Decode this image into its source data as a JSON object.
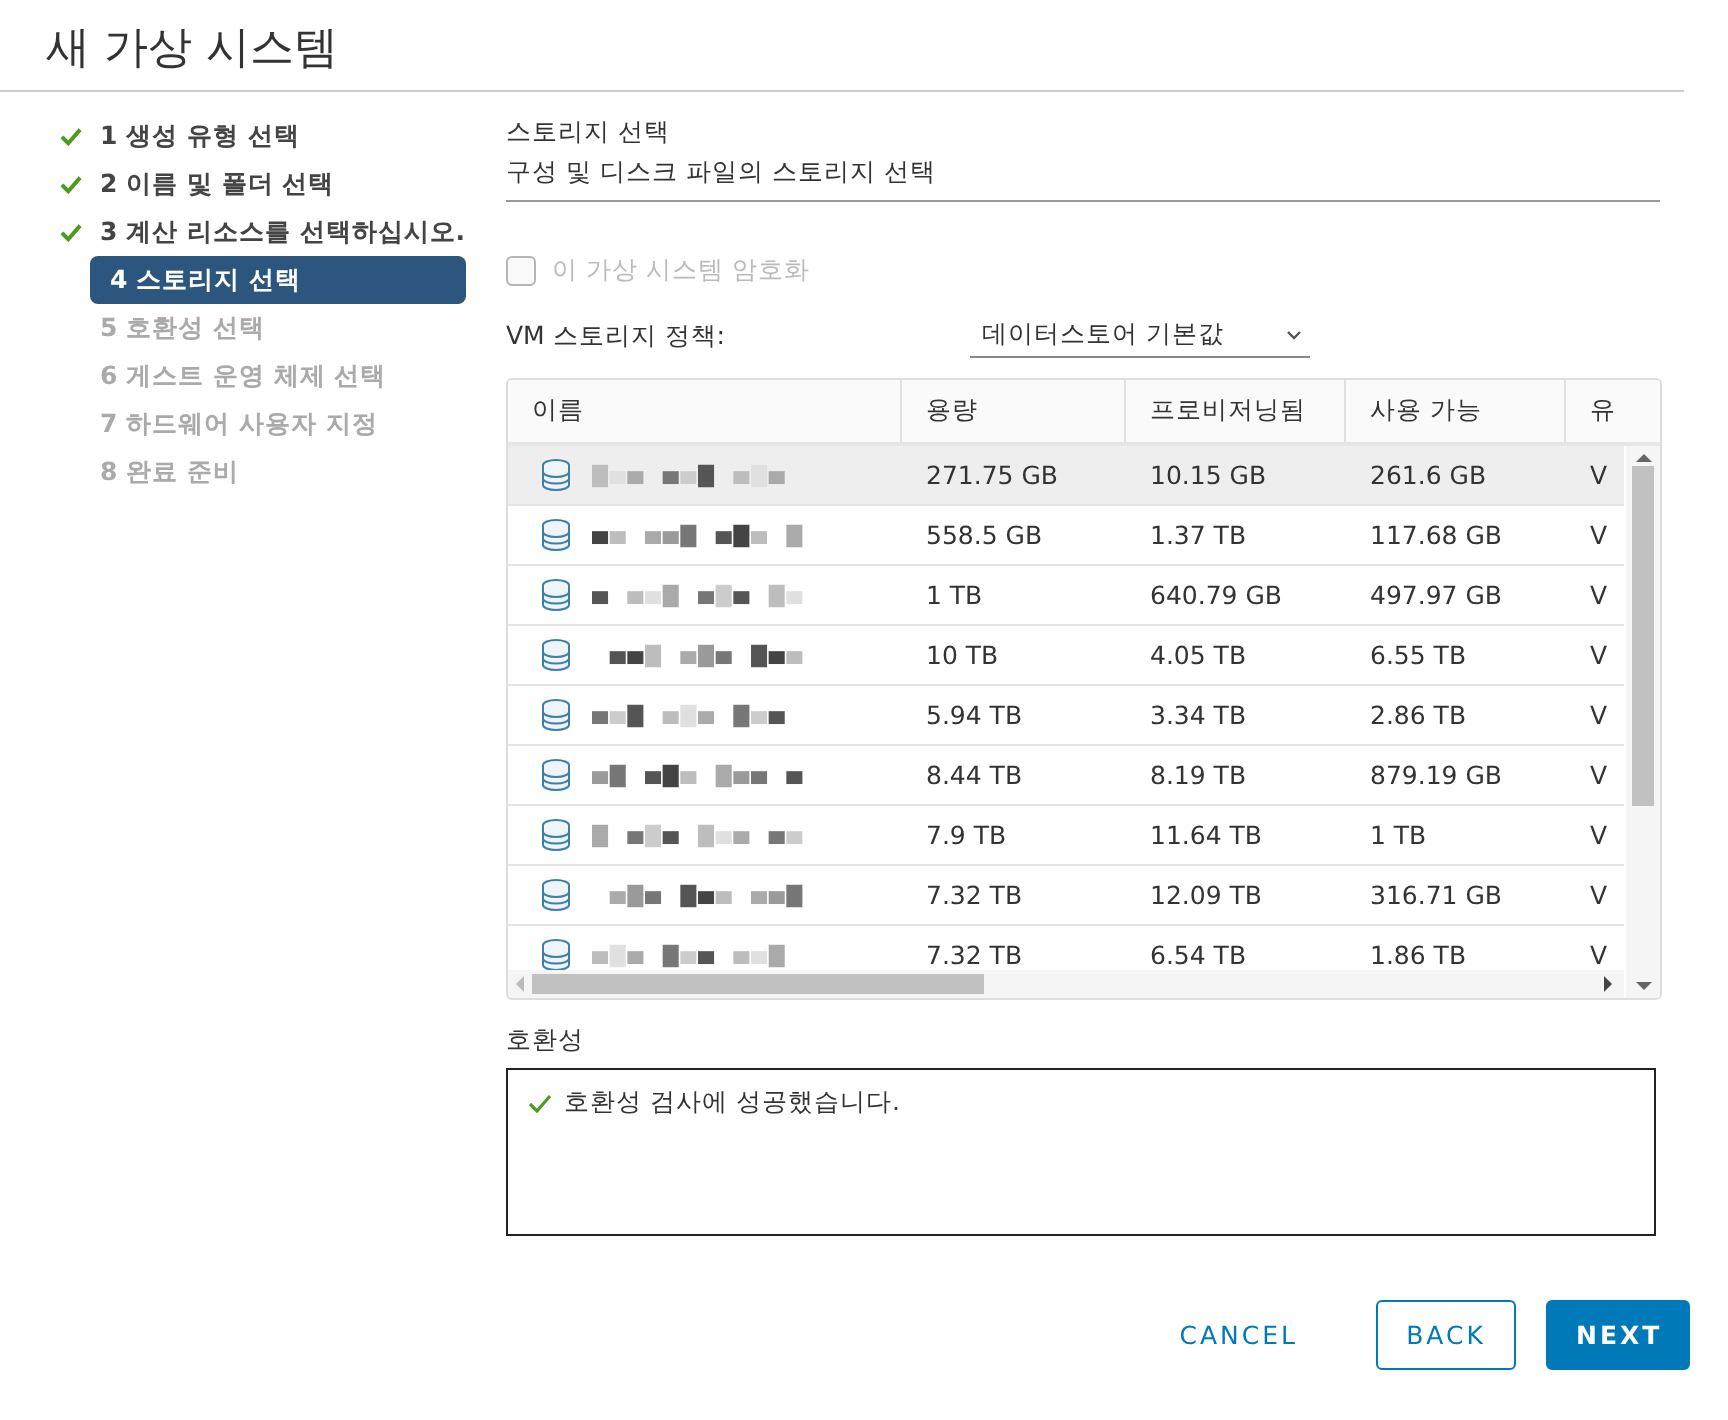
{
  "window": {
    "title": "새 가상 시스템"
  },
  "steps": [
    {
      "label": "1 생성 유형 선택",
      "done": true,
      "selected": false,
      "disabled": false
    },
    {
      "label": "2 이름 및 폴더 선택",
      "done": true,
      "selected": false,
      "disabled": false
    },
    {
      "label": "3 계산 리소스를 선택하십시오.",
      "done": true,
      "selected": false,
      "disabled": false
    },
    {
      "label": "4 스토리지 선택",
      "done": false,
      "selected": true,
      "disabled": false
    },
    {
      "label": "5 호환성 선택",
      "done": false,
      "selected": false,
      "disabled": true
    },
    {
      "label": "6 게스트 운영 체제 선택",
      "done": false,
      "selected": false,
      "disabled": true
    },
    {
      "label": "7 하드웨어 사용자 지정",
      "done": false,
      "selected": false,
      "disabled": true
    },
    {
      "label": "8 완료 준비",
      "done": false,
      "selected": false,
      "disabled": true
    }
  ],
  "section": {
    "title": "스토리지 선택",
    "subtitle": "구성 및 디스크 파일의 스토리지 선택"
  },
  "encrypt": {
    "label": "이 가상 시스템 암호화",
    "checked": false,
    "disabled": true
  },
  "policy": {
    "label": "VM 스토리지 정책:",
    "value": "데이터스토어 기본값"
  },
  "table": {
    "columns": [
      "이름",
      "용량",
      "프로비저닝됨",
      "사용 가능",
      "유"
    ],
    "rows": [
      {
        "selected": true,
        "cells": [
          "",
          "271.75 GB",
          "10.15 GB",
          "261.6 GB",
          "V"
        ]
      },
      {
        "selected": false,
        "cells": [
          "",
          "558.5 GB",
          "1.37 TB",
          "117.68 GB",
          "V"
        ]
      },
      {
        "selected": false,
        "cells": [
          "",
          "1 TB",
          "640.79 GB",
          "497.97 GB",
          "V"
        ]
      },
      {
        "selected": false,
        "cells": [
          "",
          "10 TB",
          "4.05 TB",
          "6.55 TB",
          "V"
        ]
      },
      {
        "selected": false,
        "cells": [
          "",
          "5.94 TB",
          "3.34 TB",
          "2.86 TB",
          "V"
        ]
      },
      {
        "selected": false,
        "cells": [
          "",
          "8.44 TB",
          "8.19 TB",
          "879.19 GB",
          "V"
        ]
      },
      {
        "selected": false,
        "cells": [
          "",
          "7.9 TB",
          "11.64 TB",
          "1 TB",
          "V"
        ]
      },
      {
        "selected": false,
        "cells": [
          "",
          "7.32 TB",
          "12.09 TB",
          "316.71 GB",
          "V"
        ]
      },
      {
        "selected": false,
        "cells": [
          "",
          "7.32 TB",
          "6.54 TB",
          "1.86 TB",
          "V"
        ]
      }
    ]
  },
  "compatibility": {
    "label": "호환성",
    "message": "호환성 검사에 성공했습니다.",
    "ok": true
  },
  "buttons": [
    {
      "label": "CANCEL",
      "kind": "flat"
    },
    {
      "label": "BACK",
      "kind": "outline"
    },
    {
      "label": "NEXT",
      "kind": "primary"
    }
  ]
}
